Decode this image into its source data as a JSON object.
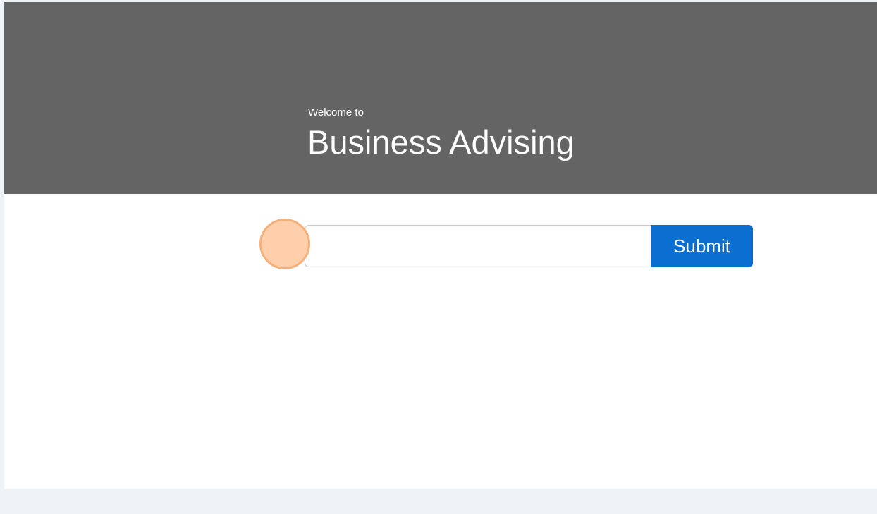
{
  "hero": {
    "subtitle": "Welcome to",
    "title": "Business Advising"
  },
  "search": {
    "value": "",
    "placeholder": ""
  },
  "submit": {
    "label": "Submit"
  },
  "colors": {
    "hero_background": "#646464",
    "submit_background": "#0a6fd1",
    "page_background": "#eff2f7",
    "click_marker": "#ffc69c"
  }
}
